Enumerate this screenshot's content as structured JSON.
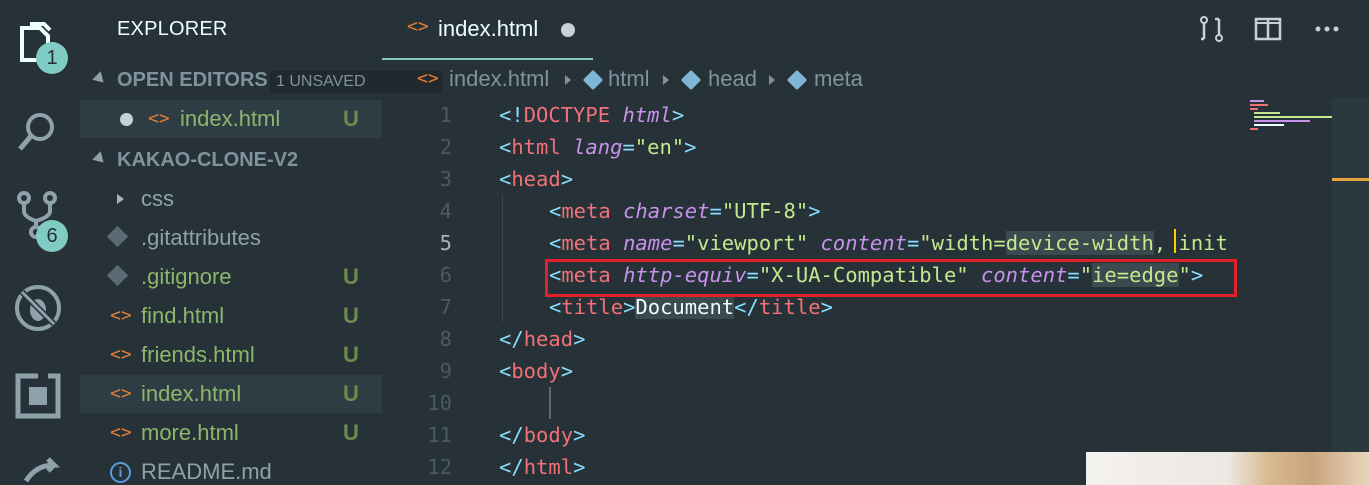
{
  "activity_bar": {
    "explorer_badge": "1",
    "scm_badge": "6"
  },
  "sidebar": {
    "title": "EXPLORER",
    "open_editors": {
      "label": "OPEN EDITORS",
      "unsaved": "1 UNSAVED",
      "items": [
        {
          "name": "index.html",
          "status": "U"
        }
      ]
    },
    "project": {
      "label": "KAKAO-CLONE-V2",
      "items": [
        {
          "name": "css",
          "type": "folder",
          "status": ""
        },
        {
          "name": ".gitattributes",
          "type": "git",
          "status": ""
        },
        {
          "name": ".gitignore",
          "type": "git",
          "status": "U"
        },
        {
          "name": "find.html",
          "type": "html",
          "status": "U"
        },
        {
          "name": "friends.html",
          "type": "html",
          "status": "U"
        },
        {
          "name": "index.html",
          "type": "html",
          "status": "U"
        },
        {
          "name": "more.html",
          "type": "html",
          "status": "U"
        },
        {
          "name": "README.md",
          "type": "info",
          "status": ""
        }
      ]
    }
  },
  "tabs": [
    {
      "label": "index.html",
      "modified": true
    }
  ],
  "breadcrumb": [
    "index.html",
    "html",
    "head",
    "meta"
  ],
  "editor": {
    "line_numbers": [
      "1",
      "2",
      "3",
      "4",
      "5",
      "6",
      "7",
      "8",
      "9",
      "10",
      "11",
      "12"
    ],
    "current_line": "5",
    "lines": {
      "l1": {
        "lt": "<!",
        "tag": "DOCTYPE",
        "attr": "html",
        "gt": ">"
      },
      "l2": {
        "lt": "<",
        "tag": "html",
        "attr": "lang",
        "eq": "=",
        "val": "\"en\"",
        "gt": ">"
      },
      "l3": {
        "lt": "<",
        "tag": "head",
        "gt": ">"
      },
      "l4": {
        "lt": "<",
        "tag": "meta",
        "attr": "charset",
        "eq": "=",
        "val": "\"UTF-8\"",
        "gt": ">"
      },
      "l5": {
        "lt": "<",
        "tag": "meta",
        "attr1": "name",
        "eq1": "=",
        "val1": "\"viewport\"",
        "attr2": "content",
        "eq2": "=",
        "val2a": "\"width=",
        "val2b": "device-width",
        "val2c": ", init"
      },
      "l6": {
        "lt": "<",
        "tag": "meta",
        "attr1": "http-equiv",
        "eq1": "=",
        "val1": "\"X-UA-Compatible\"",
        "attr2": "content",
        "eq2": "=",
        "val2a": "\"",
        "val2b": "ie=edge",
        "val2c": "\"",
        "gt": ">"
      },
      "l7": {
        "lt": "<",
        "tag": "title",
        "gt": ">",
        "text": "Document",
        "lt2": "</",
        "tag2": "title",
        "gt2": ">"
      },
      "l8": {
        "lt": "</",
        "tag": "head",
        "gt": ">"
      },
      "l9": {
        "lt": "<",
        "tag": "body",
        "gt": ">"
      },
      "l11": {
        "lt": "</",
        "tag": "body",
        "gt": ">"
      },
      "l12": {
        "lt": "</",
        "tag": "html",
        "gt": ">"
      }
    }
  }
}
